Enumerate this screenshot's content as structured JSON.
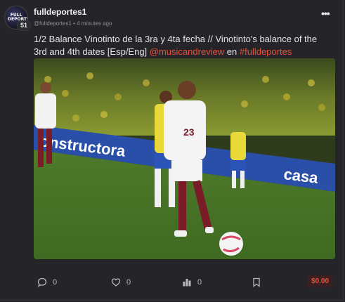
{
  "post": {
    "author_name": "fulldeportes1",
    "reputation": "51",
    "handle": "@fulldeportes1",
    "separator": "•",
    "time_ago": "4 minutes ago",
    "body_text": "1/2 Balance Vinotinto de la 3ra y 4ta fecha // Vinotinto's balance of the 3rd and 4th dates [Esp/Eng] ",
    "mention": "@musicandreview",
    "connector": " en ",
    "community": "#fulldeportes",
    "avatar_logo": "FULL DEPORTES",
    "image_texts": {
      "banner_left": "onstructora",
      "banner_right": "casa",
      "shirt_number": "23"
    }
  },
  "footer": {
    "comments_count": "0",
    "likes_count": "0",
    "views_count": "0",
    "payout": "$0.00"
  },
  "colors": {
    "accent": "#e8503a",
    "background": "#252529"
  },
  "icons": [
    "more-options-icon",
    "comment-icon",
    "heart-icon",
    "bar-chart-icon",
    "bookmark-icon"
  ]
}
